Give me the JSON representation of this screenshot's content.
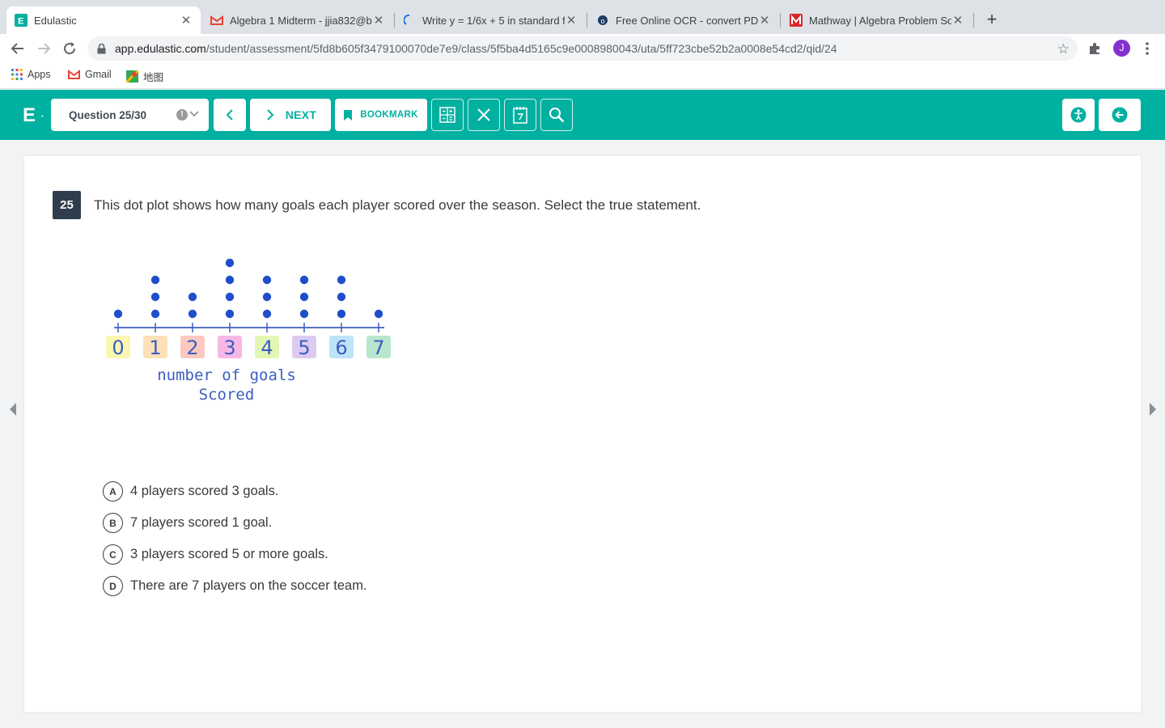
{
  "browser": {
    "tabs": [
      {
        "title": "Edulastic",
        "active": true
      },
      {
        "title": "Algebra 1 Midterm - jjia832@b",
        "active": false
      },
      {
        "title": "Write y = 1/6x + 5 in standard f",
        "active": false
      },
      {
        "title": "Free Online OCR - convert PDF",
        "active": false
      },
      {
        "title": "Mathway | Algebra Problem So",
        "active": false
      }
    ],
    "url_host": "app.edulastic.com",
    "url_path": "/student/assessment/5fd8b605f3479100070de7e9/class/5f5ba4d5165c9e0008980043/uta/5ff723cbe52b2a0008e54cd2/qid/24",
    "profile_initial": "J",
    "bookmarks": [
      {
        "label": "Apps",
        "icon": "apps-grid-icon"
      },
      {
        "label": "Gmail",
        "icon": "gmail-icon"
      },
      {
        "label": "地图",
        "icon": "maps-icon"
      }
    ]
  },
  "header": {
    "logo_text": "E",
    "question_selector": "Question 25/30",
    "next_label": "NEXT",
    "bookmark_label": "BOOKMARK",
    "accent_color": "#00b0a0"
  },
  "question": {
    "number": "25",
    "prompt": "This dot plot shows how many goals each player scored over the season. Select the true statement.",
    "choices": [
      {
        "letter": "A",
        "text": "4 players scored 3 goals."
      },
      {
        "letter": "B",
        "text": "7 players scored 1 goal."
      },
      {
        "letter": "C",
        "text": "3 players scored 5 or more goals."
      },
      {
        "letter": "D",
        "text": "There are 7 players on the soccer team."
      }
    ]
  },
  "chart_data": {
    "type": "scatter",
    "x": [
      0,
      1,
      2,
      3,
      4,
      5,
      6,
      7
    ],
    "counts": [
      1,
      3,
      2,
      4,
      3,
      3,
      3,
      1
    ],
    "tick_labels": [
      "0",
      "1",
      "2",
      "3",
      "4",
      "5",
      "6",
      "7"
    ],
    "tick_colors": [
      "#fbf7b0",
      "#fde0b8",
      "#fcc8c0",
      "#f8b6e6",
      "#e2f7b6",
      "#dccbf0",
      "#bfe3f8",
      "#b8e6cc"
    ],
    "xlabel_line1": "number of goals",
    "xlabel_line2": "Scored",
    "dot_color": "#1f4fc8"
  }
}
